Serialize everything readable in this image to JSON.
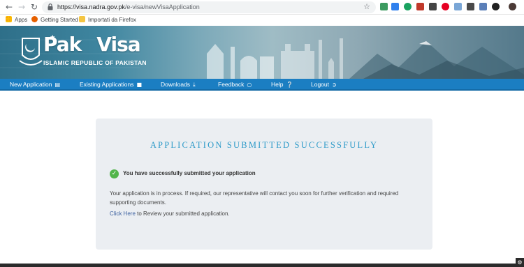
{
  "browser": {
    "url_host": "https://visa.nadra.gov.pk",
    "url_path": "/e-visa/newVisaApplication",
    "bookmarks": [
      {
        "label": "Apps",
        "icon": "apps-grid-icon"
      },
      {
        "label": "Getting Started",
        "icon": "firefox-icon"
      },
      {
        "label": "Importati da Firefox",
        "icon": "folder-icon"
      }
    ]
  },
  "site": {
    "logo_left": "Pak",
    "logo_right": "Visa",
    "logo_subtitle": "ISLAMIC REPUBLIC OF PAKISTAN"
  },
  "nav": {
    "items": [
      {
        "label": "New Application",
        "icon": "document-icon"
      },
      {
        "label": "Existing Applications",
        "icon": "briefcase-icon"
      },
      {
        "label": "Downloads",
        "icon": "download-icon"
      },
      {
        "label": "Feedback",
        "icon": "chat-icon"
      },
      {
        "label": "Help",
        "icon": "help-icon"
      },
      {
        "label": "Logout",
        "icon": "logout-icon"
      }
    ]
  },
  "panel": {
    "title": "APPLICATION SUBMITTED SUCCESSFULLY",
    "success_message": "You have successfully submitted your application",
    "info_text": "Your application is in process. If required, our representative will contact you soon for further verification and required supporting documents.",
    "review_link": "Click Here",
    "review_suffix": " to Review your submitted application."
  },
  "colors": {
    "nav_bar": "#1b7ec2",
    "title": "#2f9bc9",
    "panel_bg": "#ebeef2",
    "success_green": "#52b54b",
    "link": "#3a5f9f"
  }
}
